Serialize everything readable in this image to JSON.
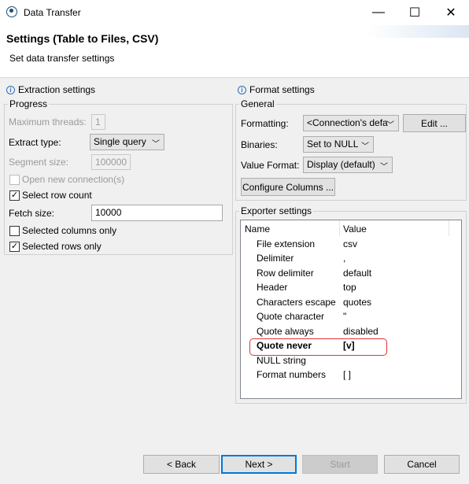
{
  "window": {
    "title": "Data Transfer",
    "minimize": "—",
    "maximize": "☐",
    "close": "✕"
  },
  "header": {
    "title": "Settings (Table to Files, CSV)",
    "subtitle": "Set data transfer settings"
  },
  "extraction": {
    "title": "Extraction settings",
    "progress_group": "Progress",
    "max_threads_label": "Maximum threads:",
    "max_threads_value": "1",
    "extract_type_label": "Extract type:",
    "extract_type_value": "Single query",
    "segment_size_label": "Segment size:",
    "segment_size_value": "100000",
    "open_new_connections": "Open new connection(s)",
    "select_row_count": "Select row count",
    "fetch_size_label": "Fetch size:",
    "fetch_size_value": "10000",
    "selected_columns_only": "Selected columns only",
    "selected_rows_only": "Selected rows only"
  },
  "format": {
    "title": "Format settings",
    "general_group": "General",
    "formatting_label": "Formatting:",
    "formatting_value": "<Connection's defa",
    "edit_button": "Edit ...",
    "binaries_label": "Binaries:",
    "binaries_value": "Set to NULL",
    "value_format_label": "Value Format:",
    "value_format_value": "Display (default)",
    "configure_columns_button": "Configure Columns ..."
  },
  "exporter": {
    "title": "Exporter settings",
    "columns": {
      "name": "Name",
      "value": "Value"
    },
    "rows": [
      {
        "name": "File extension",
        "value": "csv"
      },
      {
        "name": "Delimiter",
        "value": ","
      },
      {
        "name": "Row delimiter",
        "value": "default"
      },
      {
        "name": "Header",
        "value": "top"
      },
      {
        "name": "Characters escape",
        "value": "quotes"
      },
      {
        "name": "Quote character",
        "value": "\""
      },
      {
        "name": "Quote always",
        "value": "disabled"
      },
      {
        "name": "Quote never",
        "value": "[v]"
      },
      {
        "name": "NULL string",
        "value": ""
      },
      {
        "name": "Format numbers",
        "value": "[ ]"
      }
    ]
  },
  "footer": {
    "back": "< Back",
    "next": "Next >",
    "start": "Start",
    "cancel": "Cancel"
  },
  "checkmark": "✓",
  "colors": {
    "highlight": "#e03434",
    "accent": "#0078d7"
  }
}
